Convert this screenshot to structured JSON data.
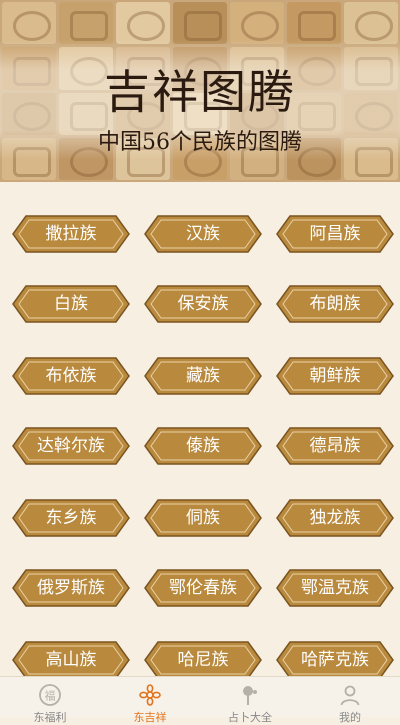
{
  "hero": {
    "title": "吉祥图腾",
    "subtitle": "中国56个民族的图腾"
  },
  "tribes": [
    "撒拉族",
    "汉族",
    "阿昌族",
    "白族",
    "保安族",
    "布朗族",
    "布依族",
    "藏族",
    "朝鲜族",
    "达斡尔族",
    "傣族",
    "德昂族",
    "东乡族",
    "侗族",
    "独龙族",
    "俄罗斯族",
    "鄂伦春族",
    "鄂温克族",
    "高山族",
    "哈尼族",
    "哈萨克族"
  ],
  "tabs": [
    {
      "label": "东福利",
      "icon": "fu-icon"
    },
    {
      "label": "东吉祥",
      "icon": "flower-icon"
    },
    {
      "label": "占卜大全",
      "icon": "divination-icon"
    },
    {
      "label": "我的",
      "icon": "profile-icon"
    }
  ],
  "colors": {
    "button_fill": "#b98a3e",
    "button_border": "#7a5420",
    "accent": "#e2731c",
    "background": "#f6efe2"
  }
}
